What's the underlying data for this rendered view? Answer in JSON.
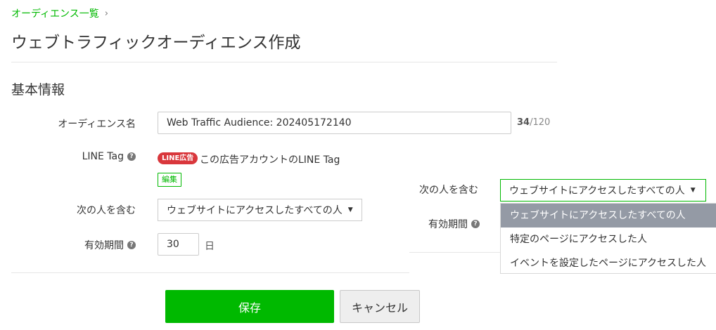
{
  "breadcrumb": {
    "parent_label": "オーディエンス一覧",
    "separator": "›"
  },
  "page": {
    "title": "ウェブトラフィックオーディエンス作成"
  },
  "basic_info": {
    "section_title": "基本情報",
    "audience_name": {
      "label": "オーディエンス名",
      "value": "Web Traffic Audience: 202405172140",
      "char_count": "34",
      "char_max": "/120"
    },
    "line_tag": {
      "label": "LINE Tag",
      "help_icon": "question-circle-icon",
      "badge": "LINE広告",
      "tag_text": "この広告アカウントのLINE Tag",
      "edit_label": "編集"
    },
    "include": {
      "label": "次の人を含む",
      "selected": "ウェブサイトにアクセスしたすべての人"
    },
    "validity": {
      "label": "有効期間",
      "help_icon": "question-circle-icon",
      "value": "30",
      "unit": "日"
    }
  },
  "overlay": {
    "include_label": "次の人を含む",
    "selected": "ウェブサイトにアクセスしたすべての人",
    "validity_label": "有効期間",
    "options": [
      "ウェブサイトにアクセスしたすべての人",
      "特定のページにアクセスした人",
      "イベントを設定したページにアクセスした人"
    ]
  },
  "actions": {
    "save_label": "保存",
    "cancel_label": "キャンセル"
  },
  "colors": {
    "accent": "#00b900",
    "badge_red": "#d9373c",
    "selected_option_bg": "#949aa5"
  }
}
